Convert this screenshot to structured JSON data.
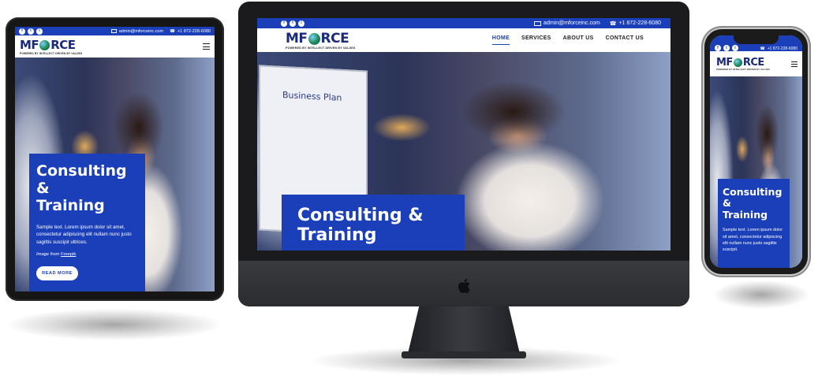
{
  "site": {
    "email": "admin@mforceinc.com",
    "phone": "+1 872-228-6080",
    "social": [
      "f",
      "t",
      "i"
    ],
    "logo": {
      "pre": "MF",
      "post": "RCE",
      "tagline": "POWERED BY INTELLECT DRIVEN BY VALUES"
    },
    "nav": [
      "HOME",
      "SERVICES",
      "ABOUT US",
      "CONTACT US"
    ],
    "hero": {
      "title_line1": "Consulting &",
      "title_line2": "Training",
      "text": "Sample text. Lorem ipsum dolor sit amet, consectetur adipiscing elit nullam nunc justo sagittis suscipit ultrices.",
      "text_short": "Sample text. Lorem ipsum dolor sit amet, consectetur adipiscing elit nullam nunc justo sagittis suscipit.",
      "credit_prefix": "Image from",
      "credit_link": "Freepik",
      "button": "READ MORE"
    },
    "board_title": "Business Plan"
  },
  "colors": {
    "brand_blue": "#1a3fb8",
    "dark_frame": "#1b1b1d"
  }
}
